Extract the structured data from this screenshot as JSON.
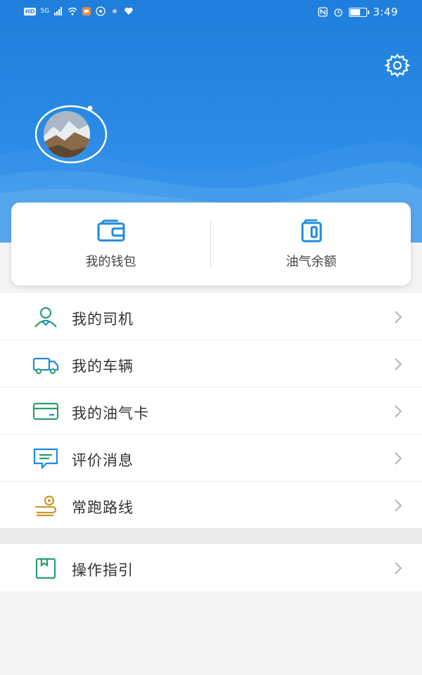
{
  "statusbar": {
    "hd": "HD",
    "net": "5G",
    "time": "3:49",
    "left_icons": [
      "signal-icon",
      "wifi-icon",
      "message-app-icon",
      "eye-app-icon",
      "app-icon",
      "heart-app-icon"
    ],
    "right_icons": [
      "nfc-icon",
      "alarm-icon",
      "battery-icon"
    ],
    "battery_level": 0.55
  },
  "header": {
    "settings_icon": "gear-icon",
    "colors": {
      "primary": "#1e7fdc",
      "accent_green": "#2a9d6a",
      "icon_blue": "#1f8be0",
      "icon_gold": "#c79a2c"
    }
  },
  "wallet": {
    "items": [
      {
        "label": "我的钱包",
        "icon": "wallet-icon"
      },
      {
        "label": "油气余额",
        "icon": "balance-icon"
      }
    ]
  },
  "menu": {
    "items": [
      {
        "label": "我的司机",
        "icon": "driver-icon"
      },
      {
        "label": "我的车辆",
        "icon": "truck-icon"
      },
      {
        "label": "我的油气卡",
        "icon": "card-icon"
      },
      {
        "label": "评价消息",
        "icon": "message-icon"
      },
      {
        "label": "常跑路线",
        "icon": "route-icon"
      }
    ],
    "guide": {
      "label": "操作指引",
      "icon": "guide-book-icon"
    }
  }
}
